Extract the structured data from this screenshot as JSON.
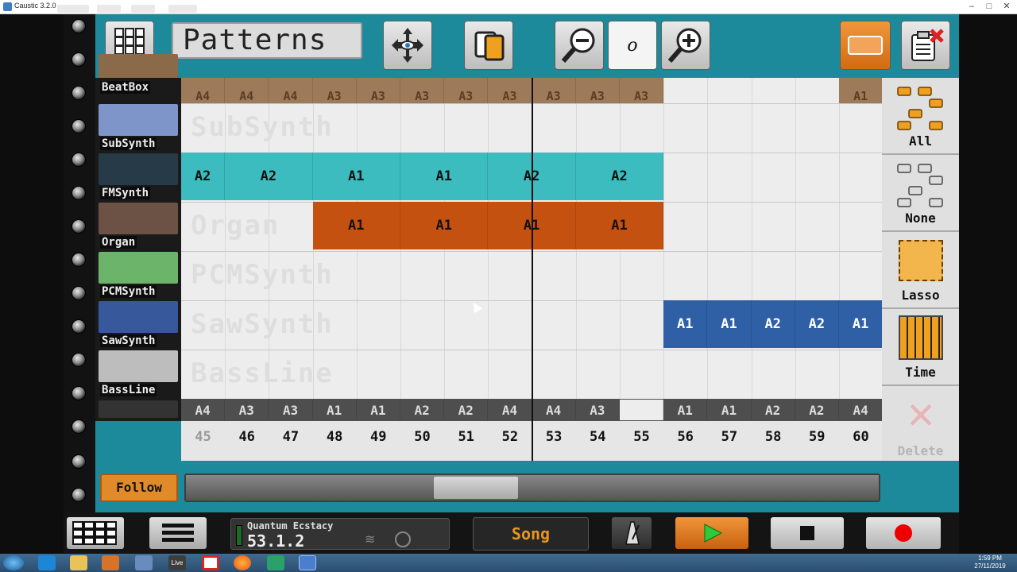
{
  "window": {
    "title": "Caustic 3.2.0",
    "minimize": "–",
    "maximize": "□",
    "close": "✕"
  },
  "toolbar": {
    "title": "Patterns",
    "grid_icon": "grid-icon",
    "move_icon": "move-arrows-icon",
    "copy_icon": "copy-icon",
    "zoom_out_icon": "zoom-out-icon",
    "zoom_level": "o",
    "zoom_in_icon": "zoom-in-icon",
    "export_icon": "export-icon",
    "clear_icon": "clear-clipboard-icon"
  },
  "instruments": [
    {
      "name": "BeatBox",
      "ghost": "",
      "color": "#8b6a4a"
    },
    {
      "name": "SubSynth",
      "ghost": "SubSynth",
      "color": "#7d95c9"
    },
    {
      "name": "FMSynth",
      "ghost": "",
      "color": "#263a47"
    },
    {
      "name": "Organ",
      "ghost": "Organ",
      "color": "#6b5244"
    },
    {
      "name": "PCMSynth",
      "ghost": "PCMSynth",
      "color": "#6bb46a"
    },
    {
      "name": "SawSynth",
      "ghost": "SawSynth",
      "color": "#38589c"
    },
    {
      "name": "BassLine",
      "ghost": "BassLine",
      "color": "#bdbdbd"
    }
  ],
  "tracks": {
    "beatbox": [
      "A4",
      "A4",
      "A4",
      "A3",
      "A3",
      "A3",
      "A3",
      "A3",
      "A3",
      "A3",
      "A3",
      "",
      "",
      "",
      "",
      "A1"
    ],
    "fmsynth": [
      {
        "label": "A2",
        "span": 1
      },
      {
        "label": "A2",
        "span": 2
      },
      {
        "label": "A1",
        "span": 2
      },
      {
        "label": "A1",
        "span": 2
      },
      {
        "label": "A2",
        "span": 2
      },
      {
        "label": "A2",
        "span": 2
      }
    ],
    "organ": [
      {
        "label": "A1",
        "span": 2
      },
      {
        "label": "A1",
        "span": 2
      },
      {
        "label": "A1",
        "span": 2
      },
      {
        "label": "A1",
        "span": 2
      }
    ],
    "sawsynth": [
      "A1",
      "A1",
      "A2",
      "A2",
      "A1"
    ],
    "sequence": [
      "A4",
      "A3",
      "A3",
      "A1",
      "A1",
      "A2",
      "A2",
      "A4",
      "A4",
      "A3",
      "",
      "A1",
      "A1",
      "A2",
      "A2",
      "A4"
    ]
  },
  "bars": [
    "45",
    "46",
    "47",
    "48",
    "49",
    "50",
    "51",
    "52",
    "53",
    "54",
    "55",
    "56",
    "57",
    "58",
    "59",
    "60"
  ],
  "right_panel": {
    "all": "All",
    "none": "None",
    "lasso": "Lasso",
    "time": "Time",
    "delete": "Delete"
  },
  "transport": {
    "follow": "Follow",
    "song_name": "Quantum Ecstacy",
    "position": "53.1.2",
    "mode": "Song",
    "metronome_icon": "metronome-icon",
    "play_icon": "play-icon",
    "stop_icon": "stop-icon",
    "record_icon": "record-icon",
    "menu_icon": "menu-icon",
    "grid_icon": "grid-icon"
  },
  "taskbar": {
    "time": "1:59 PM",
    "date": "27/11/2019",
    "live": "Live"
  },
  "colors": {
    "app_bg": "#1d8a9b",
    "fm": "#3cbcbf",
    "organ": "#c4510f",
    "saw": "#2f5fa5",
    "beatbox": "#9d7b5a",
    "follow": "#e08a2a",
    "song": "#e6951f"
  }
}
